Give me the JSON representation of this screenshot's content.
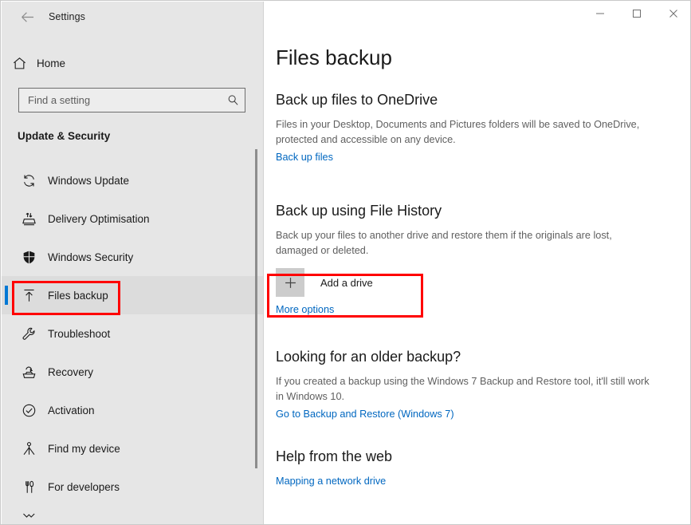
{
  "window": {
    "app_title": "Settings",
    "back_icon": "back-arrow-icon",
    "controls": {
      "minimize": "minimize-icon",
      "maximize": "maximize-icon",
      "close": "close-icon"
    }
  },
  "sidebar": {
    "home": {
      "label": "Home",
      "icon": "home-icon"
    },
    "search": {
      "placeholder": "Find a setting",
      "value": "",
      "icon": "search-icon"
    },
    "group_title": "Update & Security",
    "items": [
      {
        "label": "Windows Update",
        "icon": "refresh-icon",
        "selected": false
      },
      {
        "label": "Delivery Optimisation",
        "icon": "delivery-optimisation-icon",
        "selected": false
      },
      {
        "label": "Windows Security",
        "icon": "shield-icon",
        "selected": false
      },
      {
        "label": "Files backup",
        "icon": "upload-arrow-icon",
        "selected": true
      },
      {
        "label": "Troubleshoot",
        "icon": "wrench-icon",
        "selected": false
      },
      {
        "label": "Recovery",
        "icon": "recovery-icon",
        "selected": false
      },
      {
        "label": "Activation",
        "icon": "check-circle-icon",
        "selected": false
      },
      {
        "label": "Find my device",
        "icon": "locate-device-icon",
        "selected": false
      },
      {
        "label": "For developers",
        "icon": "tools-icon",
        "selected": false
      }
    ]
  },
  "main": {
    "page_title": "Files backup",
    "onedrive": {
      "heading": "Back up files to OneDrive",
      "description": "Files in your Desktop, Documents and Pictures folders will be saved to OneDrive, protected and accessible on any device.",
      "link": "Back up files"
    },
    "file_history": {
      "heading": "Back up using File History",
      "description": "Back up your files to another drive and restore them if the originals are lost, damaged or deleted.",
      "add_drive_label": "Add a drive",
      "add_drive_icon": "plus-icon",
      "more_options_link": "More options"
    },
    "older_backup": {
      "heading": "Looking for an older backup?",
      "description": "If you created a backup using the Windows 7 Backup and Restore tool, it'll still work in Windows 10.",
      "link": "Go to Backup and Restore (Windows 7)"
    },
    "help": {
      "heading": "Help from the web",
      "link": "Mapping a network drive"
    }
  },
  "colors": {
    "accent": "#0078d4",
    "link": "#0067c0",
    "annotation": "#ff0000",
    "sidebar_bg": "#e6e6e6"
  }
}
